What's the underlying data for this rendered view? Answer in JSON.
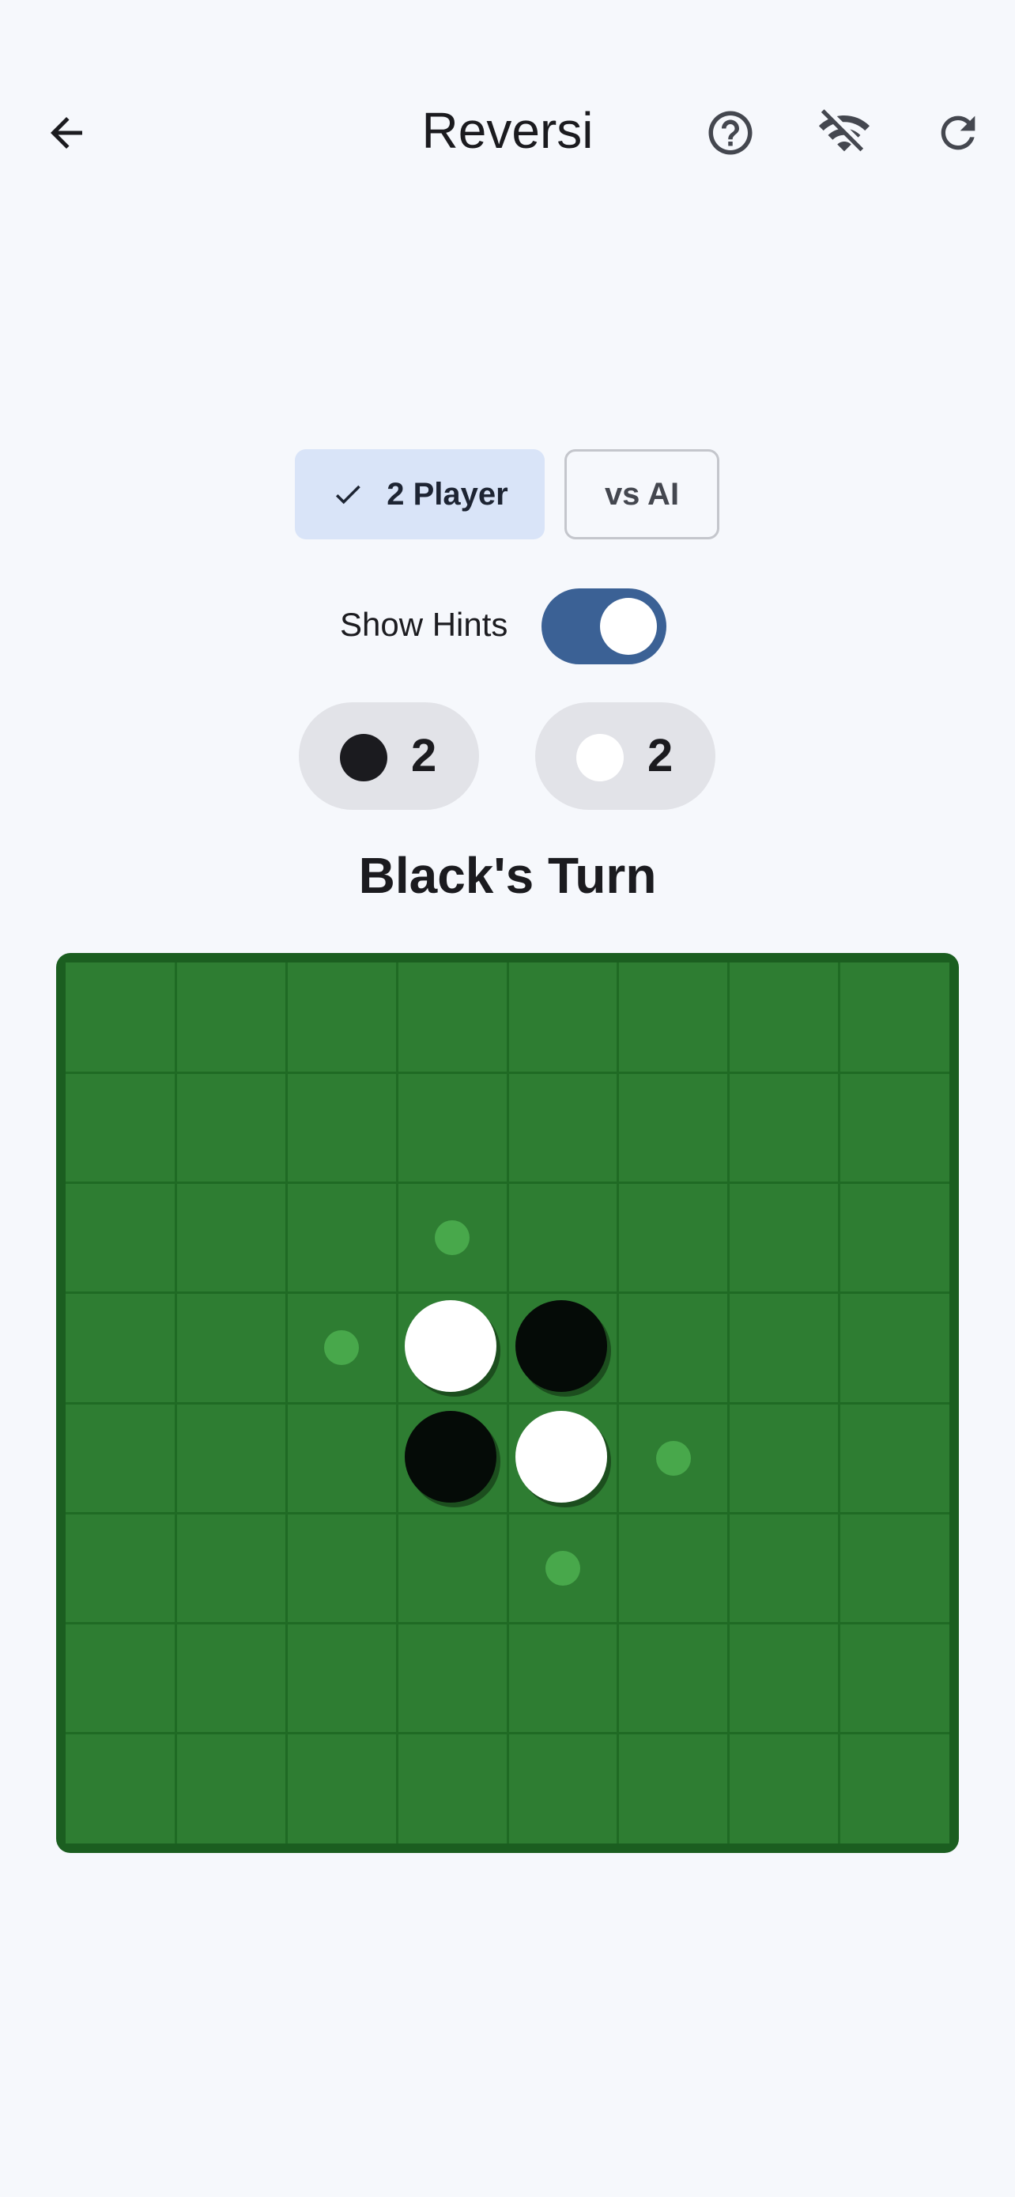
{
  "app": {
    "title": "Reversi"
  },
  "appbar": {
    "back_icon": "arrow-back-icon",
    "help_icon": "help-circle-icon",
    "online_icon": "wifi-off-icon",
    "restart_icon": "refresh-icon"
  },
  "mode": {
    "options": [
      {
        "label": "2 Player",
        "selected": true
      },
      {
        "label": "vs AI",
        "selected": false
      }
    ]
  },
  "hints": {
    "label": "Show Hints",
    "enabled": true
  },
  "scores": {
    "black": {
      "count": "2",
      "color": "#1b1b1f"
    },
    "white": {
      "count": "2",
      "color": "#ffffff"
    }
  },
  "status": {
    "turn": "Black's Turn"
  },
  "board": {
    "size": 8,
    "colors": {
      "frame": "#1b5e20",
      "surface": "#2e7d32",
      "grid": "#1f6a24",
      "hint": "#4caf50"
    },
    "pieces": [
      {
        "row": 3,
        "col": 3,
        "color": "white"
      },
      {
        "row": 3,
        "col": 4,
        "color": "black"
      },
      {
        "row": 4,
        "col": 3,
        "color": "black"
      },
      {
        "row": 4,
        "col": 4,
        "color": "white"
      }
    ],
    "hints": [
      {
        "row": 2,
        "col": 3
      },
      {
        "row": 3,
        "col": 2
      },
      {
        "row": 4,
        "col": 5
      },
      {
        "row": 5,
        "col": 4
      }
    ]
  }
}
